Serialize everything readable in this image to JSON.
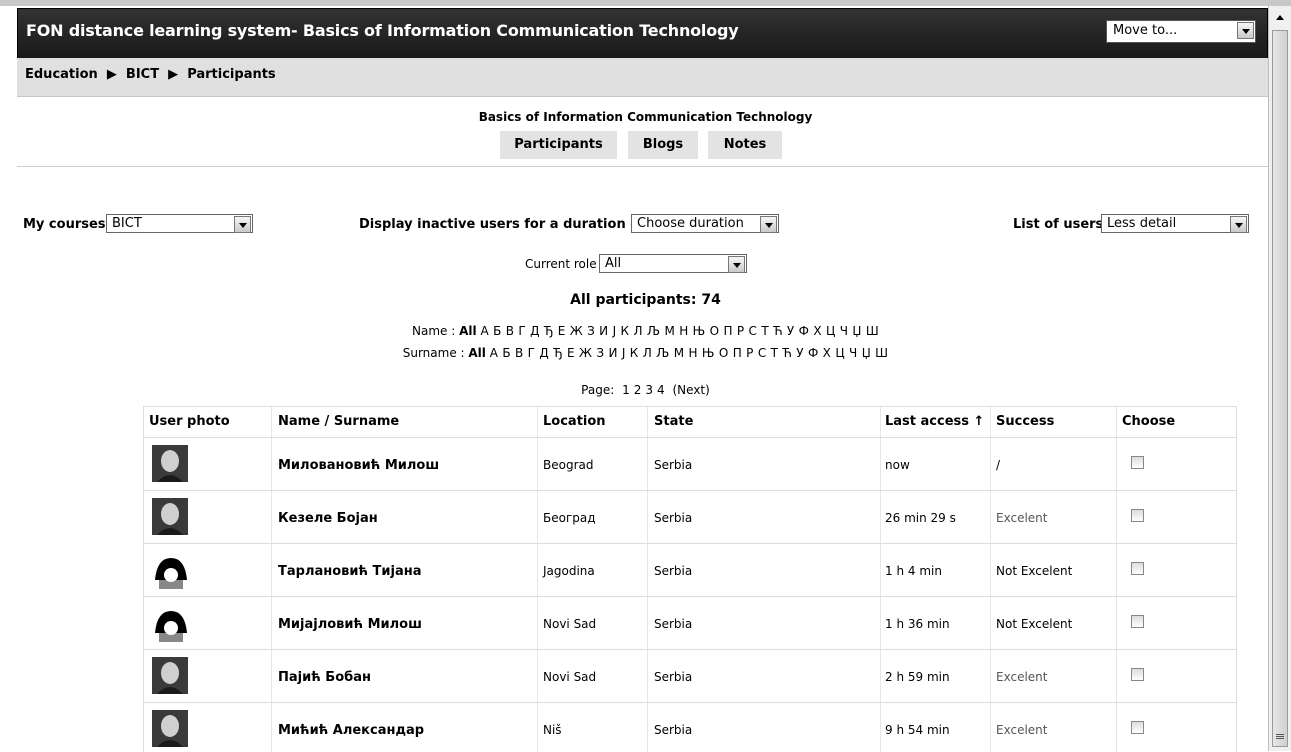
{
  "header": {
    "title": "FON distance learning system- Basics of Information Communication Technology",
    "move_to": "Move to..."
  },
  "breadcrumb": [
    "Education",
    "BICT",
    "Participants"
  ],
  "course": {
    "title": "Basics of Information Communication Technology",
    "tabs": [
      "Participants",
      "Blogs",
      "Notes"
    ]
  },
  "controls": {
    "my_courses_label": "My courses",
    "my_courses_value": "BICT",
    "inactive_label": "Display inactive users for a duration of",
    "inactive_value": "Choose duration",
    "list_label": "List of users",
    "list_value": "Less detail",
    "role_label": "Current role",
    "role_value": "All"
  },
  "participants_count": "All participants: 74",
  "alpha_name": {
    "label": "Name :",
    "all": "All",
    "letters": "А Б В Г Д Ђ Е Ж З И Ј К Л Љ М Н Њ О П Р С Т Ћ У Ф Х Ц Ч Џ Ш"
  },
  "alpha_surname": {
    "label": "Surname :",
    "all": "All",
    "letters": "А Б В Г Д Ђ Е Ж З И Ј К Л Љ М Н Њ О П Р С Т Ћ У Ф Х Ц Ч Џ Ш"
  },
  "pager": {
    "label": "Page:",
    "pages": [
      "1",
      "2",
      "3",
      "4"
    ],
    "next": "(Next)"
  },
  "table": {
    "headers": [
      "User photo",
      "Name / Surname",
      "Location",
      "State",
      "Last access",
      "Success",
      "Choose"
    ],
    "sort_arrow": "↑",
    "rows": [
      {
        "name": "Миловановић Милош",
        "location": "Beograd",
        "state": "Serbia",
        "access": "now",
        "success": "/",
        "photo": "person-photo"
      },
      {
        "name": "Кезеле Бојан",
        "location": "Београд",
        "state": "Serbia",
        "access": "26 min 29 s",
        "success": "Excelent",
        "photo": "person-photo"
      },
      {
        "name": "Тарлановић Тијана",
        "location": "Jagodina",
        "state": "Serbia",
        "access": "1 h 4 min",
        "success": "Not Excelent",
        "photo": "default-avatar"
      },
      {
        "name": "Мијајловић Милош",
        "location": "Novi Sad",
        "state": "Serbia",
        "access": "1 h 36 min",
        "success": "Not Excelent",
        "photo": "default-avatar"
      },
      {
        "name": "Пајић Бобан",
        "location": "Novi Sad",
        "state": "Serbia",
        "access": "2 h 59 min",
        "success": "Excelent",
        "photo": "person-photo"
      },
      {
        "name": "Мићић Александар",
        "location": "Niš",
        "state": "Serbia",
        "access": "9 h 54 min",
        "success": "Excelent",
        "photo": "person-photo"
      }
    ]
  },
  "colors": {
    "header_bg": "#222222",
    "crumb_bg": "#e0e0e0",
    "excelent": "#555555"
  }
}
